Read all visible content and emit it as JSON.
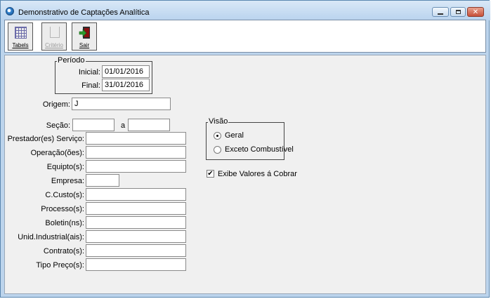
{
  "window": {
    "title": "Demonstrativo de Captações Analítica",
    "close_glyph": "✕"
  },
  "toolbar": {
    "tabels_label": "Tabels",
    "criterio_label": "Critério",
    "sair_label": "Sair"
  },
  "periodo": {
    "group_title": "Período",
    "inicial_label": "Inicial:",
    "inicial_value": "01/01/2016",
    "final_label": "Final:",
    "final_value": "31/01/2016"
  },
  "origem": {
    "label": "Origem:",
    "value": "J"
  },
  "secao": {
    "label": "Seção:",
    "from_value": "",
    "sep": "a",
    "to_value": ""
  },
  "fields": {
    "prestador_label": "Prestador(es) Serviço:",
    "operacao_label": "Operação(ões):",
    "equipto_label": "Equipto(s):",
    "empresa_label": "Empresa:",
    "ccusto_label": "C.Custo(s):",
    "processo_label": "Processo(s):",
    "boletin_label": "Boletin(ns):",
    "unid_label": "Unid.Industrial(ais):",
    "contrato_label": "Contrato(s):",
    "tipopreco_label": "Tipo Preço(s):"
  },
  "visao": {
    "group_title": "Visão",
    "option_geral": "Geral",
    "option_exceto": "Exceto Combustível",
    "selected": "Geral"
  },
  "exibe": {
    "label": "Exibe Valores á Cobrar",
    "checked": true,
    "check_glyph": "✔"
  }
}
